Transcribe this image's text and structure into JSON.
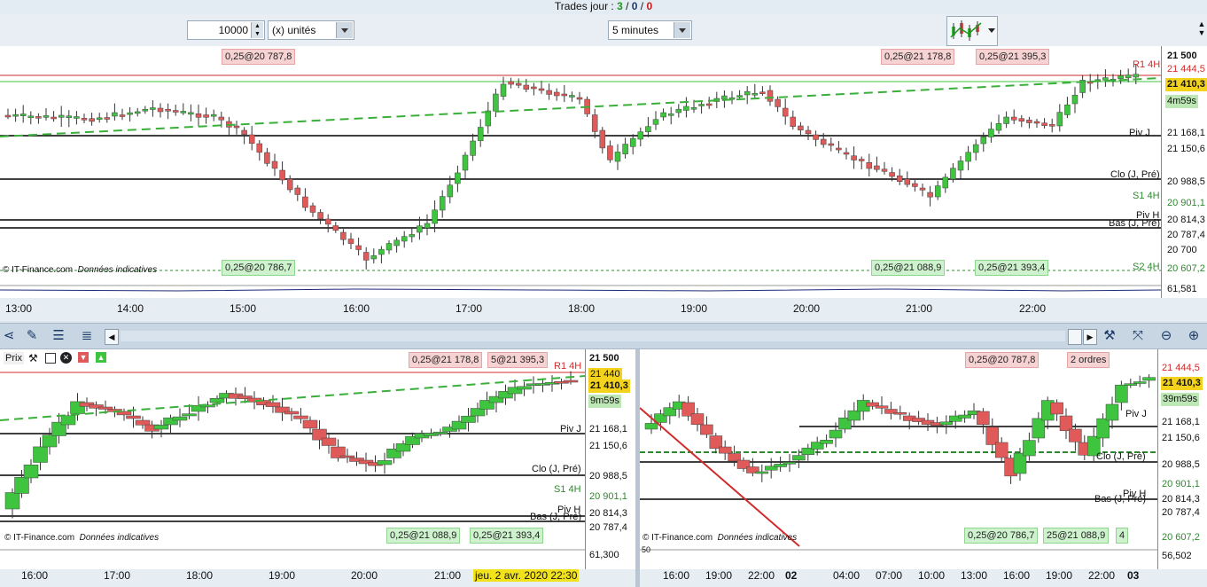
{
  "topbar": {
    "label": "Trades jour : ",
    "count1": "3",
    "sep1": " / ",
    "count2": "0",
    "sep2": " / ",
    "count3": "0"
  },
  "toolbar": {
    "quantity_value": "10000",
    "unit_select": "(x) unités",
    "interval_select": "5 minutes"
  },
  "main_chart": {
    "price_axis": [
      "21 500",
      "21 444,5",
      "21 410,3",
      "4m59s",
      "21 168,1",
      "21 150,6",
      "20 988,5",
      "20 901,1",
      "20 814,3",
      "20 787,4",
      "20 700",
      "20 607,2",
      "61,581"
    ],
    "levels": [
      "R1 4H",
      "Piv J",
      "Clo (J, Pré)",
      "S1 4H",
      "Piv H",
      "Bas (J, Pré)",
      "S2 4H"
    ],
    "order_labels_top": [
      "0,25@20 787,8",
      "0,25@21 178,8",
      "0,25@21 395,3"
    ],
    "order_labels_bottom": [
      "0,25@20 786,7",
      "0,25@21 088,9",
      "0,25@21 393,4"
    ],
    "watermark": "© IT-Finance.com",
    "watermark_note": "Données indicatives",
    "time_labels": [
      "13:00",
      "14:00",
      "15:00",
      "16:00",
      "17:00",
      "18:00",
      "19:00",
      "20:00",
      "21:00",
      "22:00"
    ]
  },
  "left_chart": {
    "title": "Prix",
    "price_axis": [
      "21 500",
      "21 440",
      "21 410,3",
      "9m59s",
      "21 168,1",
      "21 150,6",
      "20 988,5",
      "20 901,1",
      "20 814,3",
      "20 787,4",
      "61,300"
    ],
    "order_labels_top": [
      "0,25@21 178,8",
      "5@21 395,3"
    ],
    "order_labels_bottom": [
      "0,25@21 088,9",
      "0,25@21 393,4"
    ],
    "levels": [
      "R1 4H",
      "Piv J",
      "Clo (J, Pré)",
      "S1 4H",
      "Piv H",
      "Bas (J, Pré)"
    ],
    "time_labels": [
      "16:00",
      "17:00",
      "18:00",
      "19:00",
      "20:00",
      "21:00"
    ],
    "cursor_date": "jeu. 2 avr. 2020 22:30",
    "watermark": "© IT-Finance.com",
    "watermark_note": "Données indicatives"
  },
  "right_chart": {
    "price_axis": [
      "21 444,5",
      "21 410,3",
      "39m59s",
      "21 168,1",
      "21 150,6",
      "20 988,5",
      "20 901,1",
      "20 814,3",
      "20 787,4",
      "20 607,2",
      "56,502"
    ],
    "order_labels_top": [
      "0,25@20 787,8",
      "2 ordres"
    ],
    "order_labels_bottom": [
      "0,25@20 786,7",
      "25@21 088,9",
      "4"
    ],
    "levels": [
      "Piv J",
      "Clo (J, Pré)",
      "Piv H",
      "Bas (J, Pré)"
    ],
    "indicator_value": "50",
    "time_labels": [
      "16:00",
      "19:00",
      "22:00",
      "02",
      "04:00",
      "07:00",
      "10:00",
      "13:00",
      "16:00",
      "19:00",
      "22:00",
      "03"
    ],
    "watermark": "© IT-Finance.com",
    "watermark_note": "Données indicatives"
  },
  "colors": {
    "up": "#3ec43e",
    "down": "#e05a5a",
    "accent": "#1a3a66",
    "resistance": "#d12b2b",
    "support": "#2f8a2f"
  }
}
